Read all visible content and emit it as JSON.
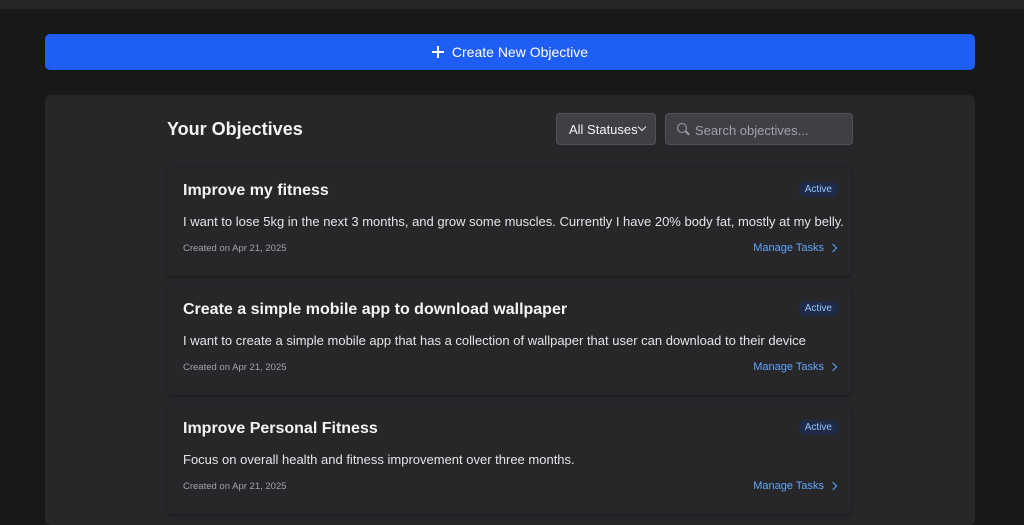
{
  "create_button": {
    "label": "Create New Objective"
  },
  "objectives_panel": {
    "title": "Your Objectives",
    "status_filter": {
      "selected": "All Statuses"
    },
    "search": {
      "placeholder": "Search objectives..."
    }
  },
  "objectives": [
    {
      "title": "Improve my fitness",
      "status": "Active",
      "description": "I want to lose 5kg in the next 3 months, and grow some muscles. Currently I have 20% body fat, mostly at my belly.",
      "created": "Created on Apr 21, 2025",
      "action": "Manage Tasks"
    },
    {
      "title": "Create a simple mobile app to download wallpaper",
      "status": "Active",
      "description": "I want to create a simple mobile app that has a collection of wallpaper that user can download to their device",
      "created": "Created on Apr 21, 2025",
      "action": "Manage Tasks"
    },
    {
      "title": "Improve Personal Fitness",
      "status": "Active",
      "description": "Focus on overall health and fitness improvement over three months.",
      "created": "Created on Apr 21, 2025",
      "action": "Manage Tasks"
    }
  ],
  "colors": {
    "background": "#18181b",
    "panel": "#27272a",
    "primary_button": "#1f5ef5",
    "link": "#60a5fa",
    "badge_text": "#93c5fd"
  }
}
